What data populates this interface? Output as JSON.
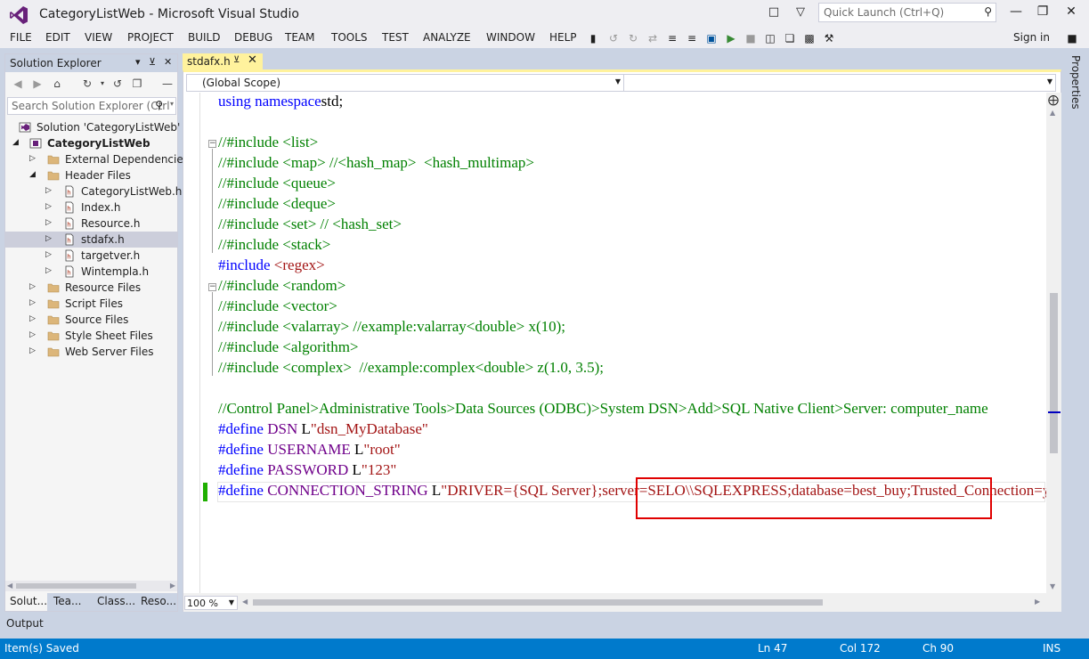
{
  "window": {
    "title": "CategoryListWeb - Microsoft Visual Studio",
    "quick_launch_placeholder": "Quick Launch (Ctrl+Q)"
  },
  "menu": [
    "FILE",
    "EDIT",
    "VIEW",
    "PROJECT",
    "BUILD",
    "DEBUG",
    "TEAM",
    "TOOLS",
    "TEST",
    "ANALYZE",
    "WINDOW",
    "HELP"
  ],
  "sign_in": "Sign in",
  "solution_explorer": {
    "title": "Solution Explorer",
    "search_placeholder": "Search Solution Explorer (Ctrl",
    "tree": [
      {
        "label": "Solution 'CategoryListWeb' (1",
        "level": 0,
        "arrow": "",
        "icon": "solution-icon"
      },
      {
        "label": "CategoryListWeb",
        "level": 1,
        "arrow": "expanded",
        "icon": "project-icon",
        "bold": true
      },
      {
        "label": "External Dependencies",
        "level": 2,
        "arrow": "collapsed",
        "icon": "folder-icon"
      },
      {
        "label": "Header Files",
        "level": 2,
        "arrow": "expanded",
        "icon": "folder-icon"
      },
      {
        "label": "CategoryListWeb.h",
        "level": 3,
        "arrow": "collapsed",
        "icon": "header-file-icon"
      },
      {
        "label": "Index.h",
        "level": 3,
        "arrow": "collapsed",
        "icon": "header-file-icon"
      },
      {
        "label": "Resource.h",
        "level": 3,
        "arrow": "collapsed",
        "icon": "header-file-icon"
      },
      {
        "label": "stdafx.h",
        "level": 3,
        "arrow": "collapsed",
        "icon": "header-file-icon",
        "selected": true
      },
      {
        "label": "targetver.h",
        "level": 3,
        "arrow": "collapsed",
        "icon": "header-file-icon"
      },
      {
        "label": "Wintempla.h",
        "level": 3,
        "arrow": "collapsed",
        "icon": "header-file-icon"
      },
      {
        "label": "Resource Files",
        "level": 2,
        "arrow": "collapsed",
        "icon": "folder-icon"
      },
      {
        "label": "Script Files",
        "level": 2,
        "arrow": "collapsed",
        "icon": "folder-icon"
      },
      {
        "label": "Source Files",
        "level": 2,
        "arrow": "collapsed",
        "icon": "folder-icon"
      },
      {
        "label": "Style Sheet Files",
        "level": 2,
        "arrow": "collapsed",
        "icon": "folder-icon"
      },
      {
        "label": "Web Server Files",
        "level": 2,
        "arrow": "collapsed",
        "icon": "folder-icon"
      }
    ],
    "tabs": [
      "Solut...",
      "Tea...",
      "Class...",
      "Reso..."
    ]
  },
  "editor": {
    "tab_label": "stdafx.h",
    "scope": "(Global Scope)",
    "zoom": "100 %",
    "lines": [
      [
        [
          "kw",
          "using namespace"
        ],
        [
          "",
          "std;"
        ]
      ],
      [],
      [
        [
          "cm",
          "//#include <list>"
        ]
      ],
      [
        [
          "cm",
          "//#include <map> //<hash_map>  <hash_multimap>"
        ]
      ],
      [
        [
          "cm",
          "//#include <queue>"
        ]
      ],
      [
        [
          "cm",
          "//#include <deque>"
        ]
      ],
      [
        [
          "cm",
          "//#include <set> // <hash_set>"
        ]
      ],
      [
        [
          "cm",
          "//#include <stack>"
        ]
      ],
      [
        [
          "pp",
          "#include "
        ],
        [
          "inc",
          "<regex>"
        ]
      ],
      [
        [
          "cm",
          "//#include <random>"
        ]
      ],
      [
        [
          "cm",
          "//#include <vector>"
        ]
      ],
      [
        [
          "cm",
          "//#include <valarray> //example:valarray<double> x(10);"
        ]
      ],
      [
        [
          "cm",
          "//#include <algorithm>"
        ]
      ],
      [
        [
          "cm",
          "//#include <complex>  //example:complex<double> z(1.0, 3.5);"
        ]
      ],
      [],
      [
        [
          "cm",
          "//Control Panel>Administrative Tools>Data Sources (ODBC)>System DSN>Add>SQL Native Client>Server: computer_name"
        ]
      ],
      [
        [
          "pp",
          "#define "
        ],
        [
          "mac",
          "DSN "
        ],
        [
          "",
          "L"
        ],
        [
          "str",
          "\"dsn_MyDatabase\""
        ]
      ],
      [
        [
          "pp",
          "#define "
        ],
        [
          "mac",
          "USERNAME "
        ],
        [
          "",
          "L"
        ],
        [
          "str",
          "\"root\""
        ]
      ],
      [
        [
          "pp",
          "#define "
        ],
        [
          "mac",
          "PASSWORD "
        ],
        [
          "",
          "L"
        ],
        [
          "str",
          "\"123\""
        ]
      ],
      [
        [
          "pp",
          "#define "
        ],
        [
          "mac",
          "CONNECTION_STRING "
        ],
        [
          "",
          "L"
        ],
        [
          "str",
          "\"DRIVER={SQL Server};server=SELO\\\\SQLEXPRESS;database=best_buy;Trusted_Connection=yes;\""
        ]
      ]
    ]
  },
  "properties_label": "Properties",
  "output_label": "Output",
  "status": {
    "message": "Item(s) Saved",
    "line": "Ln 47",
    "col": "Col 172",
    "ch": "Ch 90",
    "mode": "INS"
  },
  "colors": {
    "accent": "#007ACC",
    "tab_active": "#FFF29D",
    "comment": "#008000",
    "keyword": "#0000FF",
    "macro": "#6F008A",
    "string": "#A31515",
    "highlight_box": "#E00000"
  }
}
